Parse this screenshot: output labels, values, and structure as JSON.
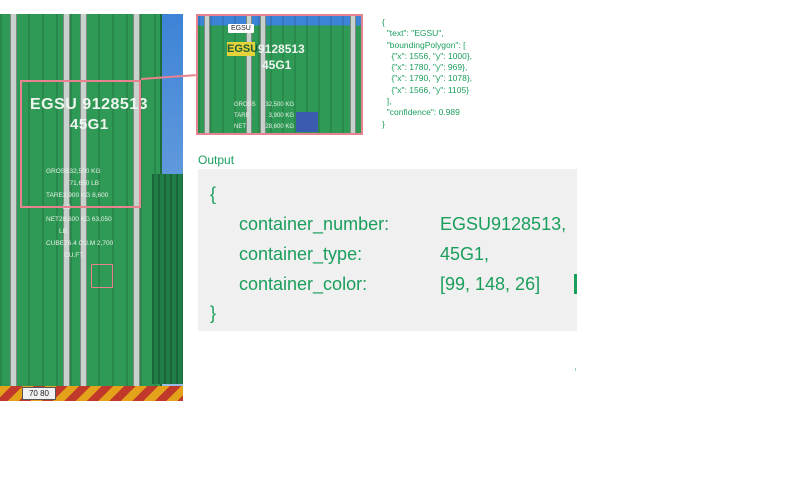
{
  "photo": {
    "container_number": "EGSU 9128513",
    "container_type": "45G1",
    "specs": [
      {
        "label": "GROSS",
        "value": "32,500 KG 71,650 LB"
      },
      {
        "label": "TARE",
        "value": "3,900 KG 8,600 LB"
      },
      {
        "label": "NET",
        "value": "28,600 KG 63,050 LB"
      },
      {
        "label": "CUBE",
        "value": "76.4 CU.M 2,700 CU.FT"
      }
    ],
    "plate_text": "70 80"
  },
  "zoom": {
    "tag_label": "EGSU",
    "highlighted_word": "EGSU",
    "number_rest": "9128513",
    "type_code": "45G1",
    "spec_rows": [
      {
        "label": "GROSS",
        "value": "32,500 KG"
      },
      {
        "label": "TARE",
        "value": "3,900 KG"
      },
      {
        "label": "NET",
        "value": "28,600 KG"
      }
    ]
  },
  "json_annotation": "{\n  \"text\": \"EGSU\",\n  \"boundingPolygon\": [\n    {\"x\": 1556, \"y\": 1000},\n    {\"x\": 1780, \"y\": 969},\n    {\"x\": 1790, \"y\": 1078},\n    {\"x\": 1566, \"y\": 1105}\n  ],\n  \"confidence\": 0.989\n}",
  "output": {
    "label": "Output",
    "open_brace": "{",
    "close_brace": "}",
    "fields": [
      {
        "key": "container_number:",
        "value": "EGSU9128513,"
      },
      {
        "key": "container_type:",
        "value": "45G1,"
      },
      {
        "key": "container_color:",
        "value": "[99, 148, 26]"
      }
    ]
  },
  "colors": {
    "accent_green": "#1a9e5c",
    "highlight_pink": "#e9828f",
    "panel_gray": "#f0f0f0"
  }
}
